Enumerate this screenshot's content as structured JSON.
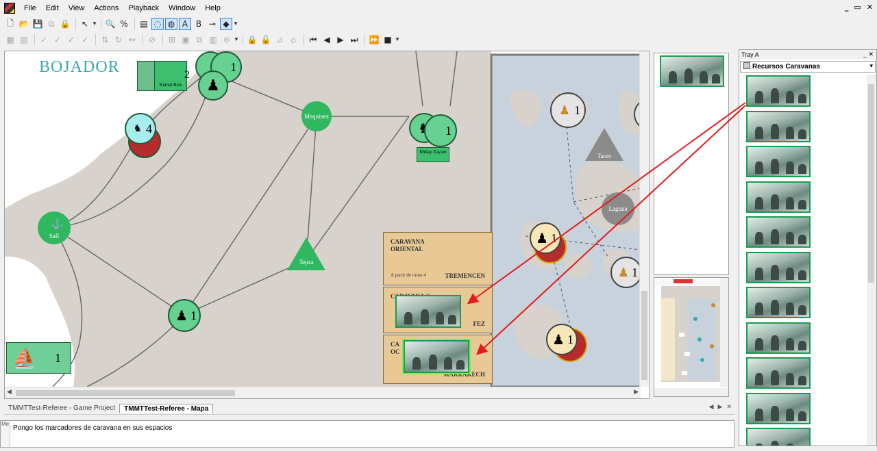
{
  "menu": [
    "File",
    "Edit",
    "View",
    "Actions",
    "Playback",
    "Window",
    "Help"
  ],
  "window_controls": [
    "_",
    "▭",
    "✕"
  ],
  "map": {
    "title": "BOJADOR",
    "nodes": [
      "Mequinez",
      "Safi",
      "Tepza",
      "Taoro",
      "Laguna"
    ],
    "pieces": {
      "bojador_count": "2",
      "top_stack_count": "1",
      "cyan_count": "4",
      "mulay_count": "1",
      "tepza_count": "1",
      "ship_count": "1",
      "isle1_count": "1",
      "isle2_count": "1",
      "isle3_count": "1",
      "isle4_count": "1",
      "stack_top_count": "1"
    },
    "labels": {
      "kemal": "Kemal Reis",
      "mulay": "Mulay Zayam"
    },
    "caravans": {
      "oriental_title": "CARAVANA ORIENTAL",
      "oriental_sub": "A partir de turno 4",
      "oriental_city": "TREMENCEN",
      "middle_title": "CARAVANA C",
      "middle_city": "FEZ",
      "lower_title": "CA OC",
      "lower_city": "MARRAKECH"
    }
  },
  "tabs": [
    "TMMTTest-Referee - Game Project",
    "TMMTTest-Referee - Mapa"
  ],
  "chat": {
    "side_label": "Me",
    "message": "Pongo los marcadores de caravana en sus espacios"
  },
  "tray": {
    "title": "Tray A",
    "selector": "Recursos Caravanas",
    "card_count": 11
  },
  "colors": {
    "node_green": "#2fb85f",
    "piece_green": "#66d190",
    "arrow_red": "#e31b1b",
    "land": "#d8d2cc",
    "sea_map": "#c8d2dc",
    "caravan_box": "#e8c996"
  }
}
